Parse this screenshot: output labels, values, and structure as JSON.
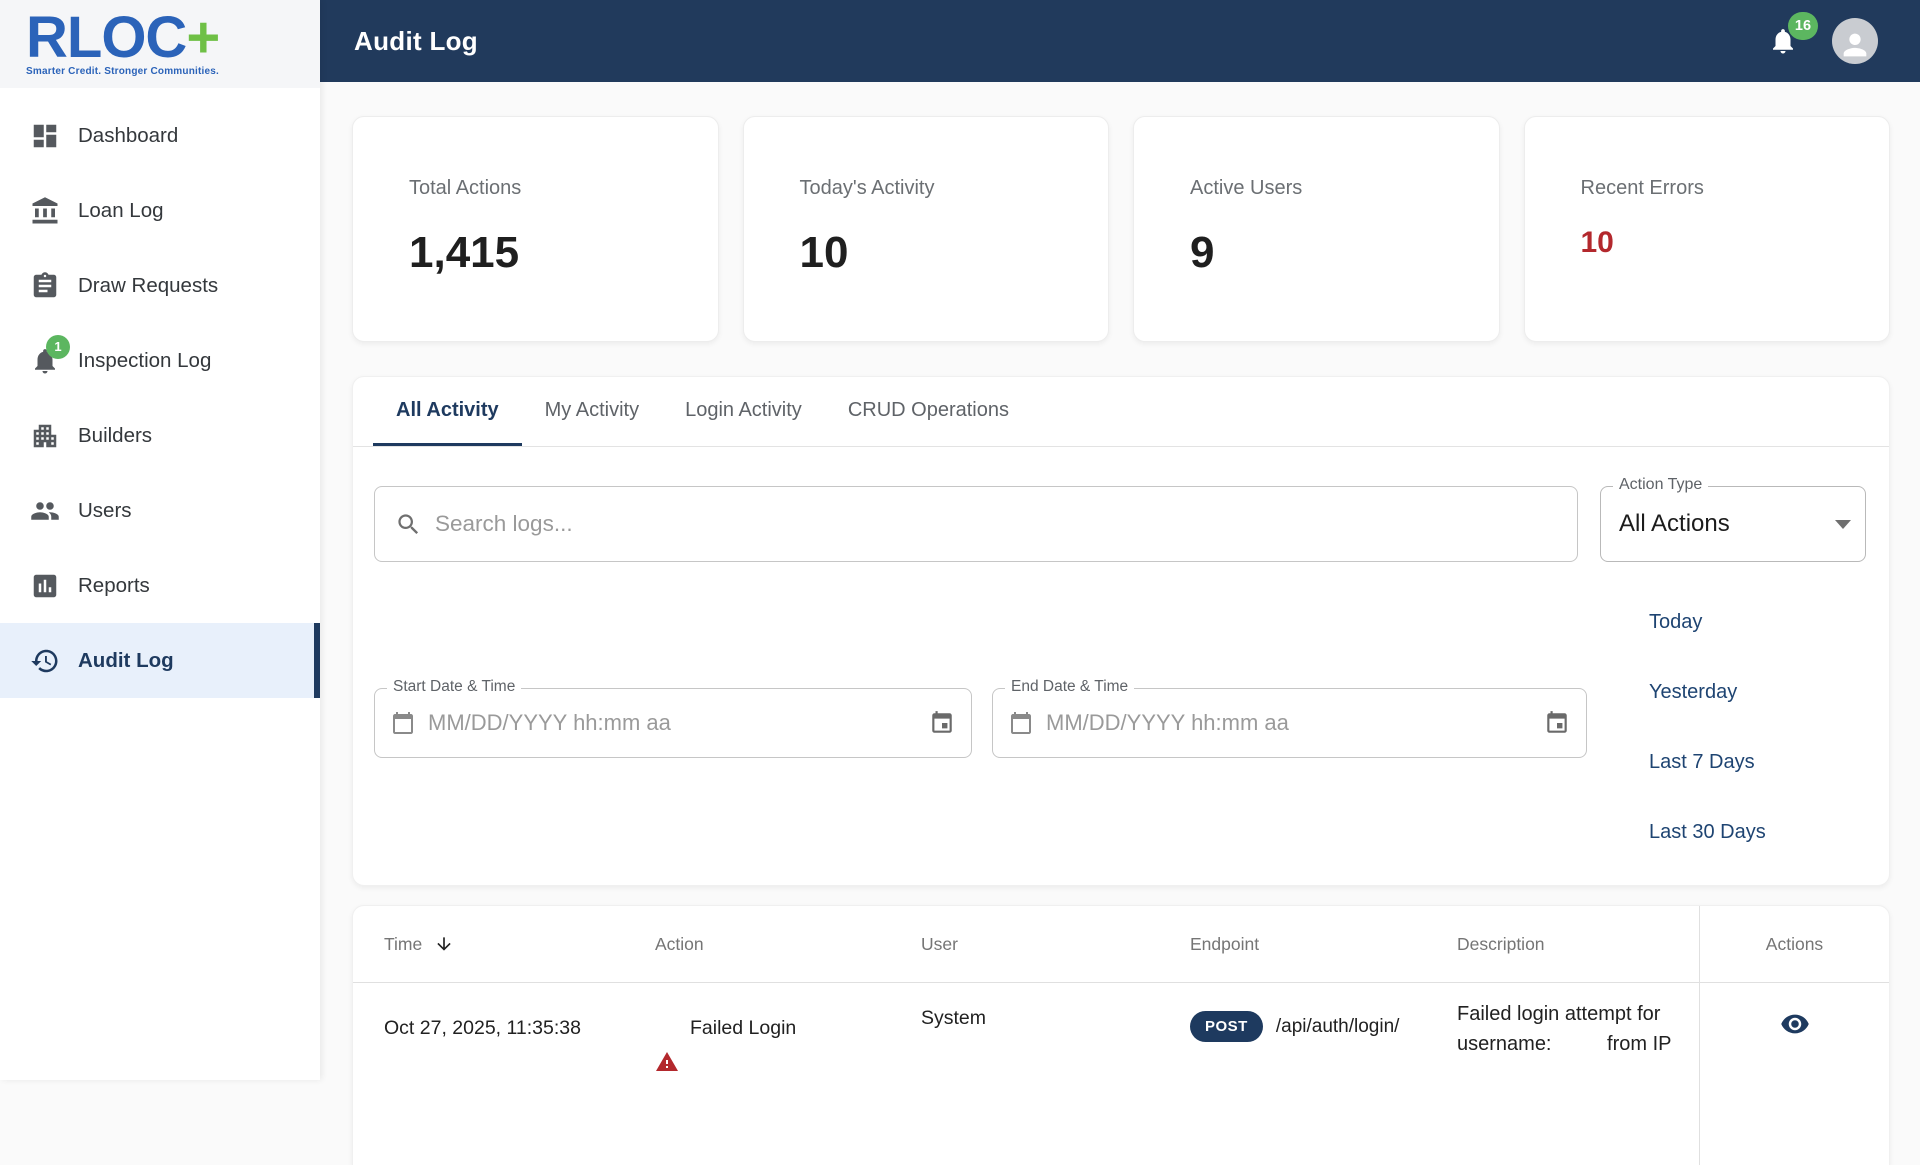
{
  "brand": {
    "name": "RLOC",
    "plus": "+",
    "tagline": "Smarter Credit. Stronger Communities."
  },
  "header": {
    "title": "Audit Log",
    "notification_count": "16"
  },
  "sidebar": {
    "items": [
      {
        "label": "Dashboard",
        "icon": "dashboard-grid-icon"
      },
      {
        "label": "Loan Log",
        "icon": "bank-icon"
      },
      {
        "label": "Draw Requests",
        "icon": "clipboard-icon"
      },
      {
        "label": "Inspection Log",
        "icon": "bell-icon",
        "badge": "1"
      },
      {
        "label": "Builders",
        "icon": "building-icon"
      },
      {
        "label": "Users",
        "icon": "people-icon"
      },
      {
        "label": "Reports",
        "icon": "bar-chart-icon"
      },
      {
        "label": "Audit Log",
        "icon": "history-icon",
        "active": true
      }
    ]
  },
  "stats": {
    "cards": [
      {
        "label": "Total Actions",
        "value": "1,415"
      },
      {
        "label": "Today's Activity",
        "value": "10"
      },
      {
        "label": "Active Users",
        "value": "9"
      },
      {
        "label": "Recent Errors",
        "value": "10",
        "color": "#b3282d"
      }
    ]
  },
  "tabs": [
    {
      "label": "All Activity",
      "active": true
    },
    {
      "label": "My Activity"
    },
    {
      "label": "Login Activity"
    },
    {
      "label": "CRUD Operations"
    }
  ],
  "filters": {
    "search_placeholder": "Search logs...",
    "action_type_label": "Action Type",
    "action_type_value": "All Actions",
    "start_label": "Start Date & Time",
    "end_label": "End Date & Time",
    "date_placeholder": "MM/DD/YYYY hh:mm aa",
    "quick_ranges": {
      "today": "Today",
      "yesterday": "Yesterday",
      "last7": "Last 7 Days",
      "last30": "Last 30 Days"
    }
  },
  "table": {
    "columns": {
      "time": "Time",
      "action": "Action",
      "user": "User",
      "endpoint": "Endpoint",
      "description": "Description",
      "actions": "Actions"
    },
    "rows": [
      {
        "time": "Oct 27, 2025, 11:35:38",
        "action": "Failed Login",
        "action_warning": true,
        "user": "System",
        "method": "POST",
        "endpoint": "/api/auth/login/",
        "description_line1": "Failed login attempt for",
        "description_line2": "username:          from IP"
      }
    ]
  },
  "colors": {
    "header_navy": "#213a5c",
    "primary_navy": "#1e3a5f",
    "link_blue": "#1e4472",
    "badge_green": "#5cb660",
    "error_red": "#b3282d",
    "logo_blue": "#2b63b9",
    "logo_green": "#6fc046",
    "active_item_bg": "#e8f0fb"
  }
}
